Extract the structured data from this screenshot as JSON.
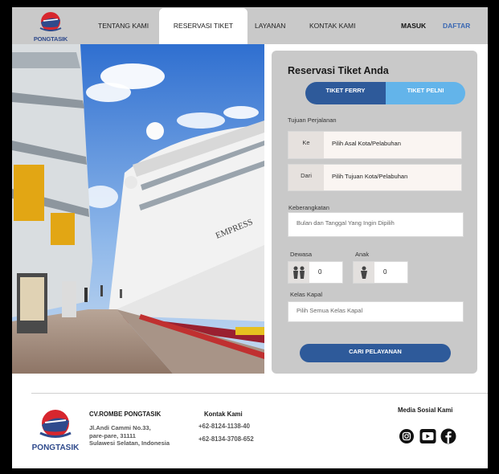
{
  "brand": {
    "name": "PONGTASIK"
  },
  "nav": {
    "items": [
      "TENTANG KAMI",
      "RESERVASI TIKET",
      "LAYANAN",
      "KONTAK KAMI"
    ],
    "active": "RESERVASI TIKET",
    "masuk": "MASUK",
    "daftar": "DAFTAR"
  },
  "hero": {
    "ship_text": "EMPRESS"
  },
  "booking": {
    "title": "Reservasi Tiket Anda",
    "tabs": [
      "TIKET FERRY",
      "TIKET PELNI"
    ],
    "active_tab": "TIKET FERRY",
    "tujuan_label": "Tujuan Perjalanan",
    "ke_label": "Ke",
    "ke_placeholder": "Pilih Asal Kota/Pelabuhan",
    "dari_label": "Dari",
    "dari_placeholder": "Pilih Tujuan Kota/Pelabuhan",
    "keberangkatan_label": "Keberangkatan",
    "keberangkatan_placeholder": "Bulan dan Tanggal Yang Ingin Dipilih",
    "dewasa_label": "Dewasa",
    "dewasa_value": "0",
    "anak_label": "Anak",
    "anak_value": "0",
    "kelas_label": "Kelas Kapal",
    "kelas_placeholder": "Pilih Semua Kelas Kapal",
    "submit": "CARI PELAYANAN"
  },
  "footer": {
    "company": "CV.ROMBE PONGTASIK",
    "address_lines": [
      "Jl.Andi Cammi No.33,",
      "pare-pare, 31111",
      "Sulawesi Selatan, Indonesia"
    ],
    "contact_title": "Kontak Kami",
    "phones": [
      "+62-8124-1138-40",
      "+62-8134-3708-652"
    ],
    "social_title": "Media Sosial Kami",
    "social_icons": [
      "instagram-icon",
      "youtube-icon",
      "facebook-icon"
    ]
  },
  "colors": {
    "nav_bg": "#c9c9c9",
    "accent_dark": "#2e5a9a",
    "accent_light": "#63b4ea",
    "daftar": "#3a68b3"
  }
}
